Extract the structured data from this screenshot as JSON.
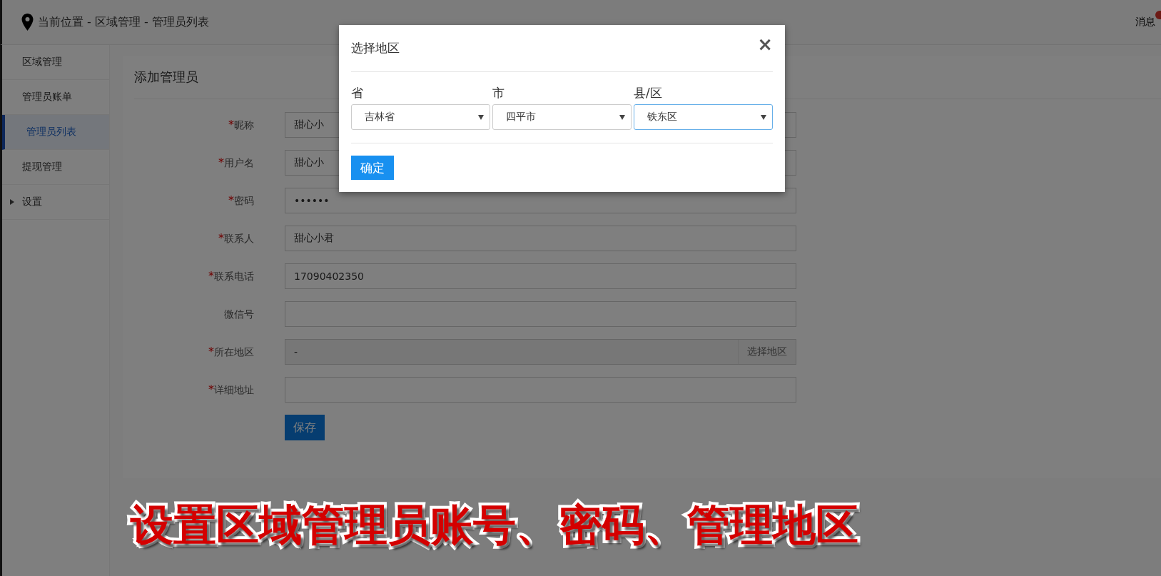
{
  "header": {
    "breadcrumb": "当前位置 - 区域管理 - 管理员列表",
    "messages": {
      "label": "消息",
      "unread": true
    }
  },
  "sidebar": {
    "items": [
      {
        "label": "区域管理",
        "selected": false,
        "kind": "link"
      },
      {
        "label": "管理员账单",
        "selected": false,
        "kind": "link"
      },
      {
        "label": "管理员列表",
        "selected": true,
        "kind": "link"
      },
      {
        "label": "提现管理",
        "selected": false,
        "kind": "link"
      },
      {
        "label": "设置",
        "selected": false,
        "kind": "group",
        "expanded": false
      }
    ]
  },
  "form": {
    "title": "添加管理员",
    "fields": [
      {
        "label": "昵称",
        "required": true,
        "value": "甜心小",
        "kind": "text"
      },
      {
        "label": "用户名",
        "required": true,
        "value": "甜心小",
        "kind": "text"
      },
      {
        "label": "密码",
        "required": true,
        "value": "••••••",
        "kind": "text"
      },
      {
        "label": "联系人",
        "required": true,
        "value": "甜心小君",
        "kind": "text"
      },
      {
        "label": "联系电话",
        "required": true,
        "value": "17090402350",
        "kind": "text"
      },
      {
        "label": "微信号",
        "required": false,
        "kind": "text"
      },
      {
        "label": "所在地区",
        "required": true,
        "value": "-",
        "kind": "region",
        "button": "选择地区"
      },
      {
        "label": "详细地址",
        "required": true,
        "kind": "text"
      }
    ],
    "required_mark": "*",
    "submit": "保存"
  },
  "modal": {
    "title": "选择地区",
    "close": "×",
    "selects": [
      {
        "label": "省",
        "value": "吉林省",
        "focused": false
      },
      {
        "label": "市",
        "value": "四平市",
        "focused": false
      },
      {
        "label": "县/区",
        "value": "铁东区",
        "focused": true
      }
    ],
    "confirm": "确定"
  },
  "caption": "设置区域管理员账号、密码、管理地区"
}
